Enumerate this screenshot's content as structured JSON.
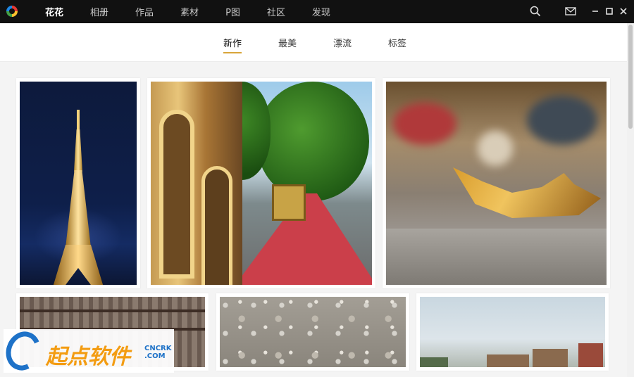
{
  "titlebar": {
    "nav": [
      {
        "label": "花花",
        "active": true
      },
      {
        "label": "相册",
        "active": false
      },
      {
        "label": "作品",
        "active": false
      },
      {
        "label": "素材",
        "active": false
      },
      {
        "label": "P图",
        "active": false
      },
      {
        "label": "社区",
        "active": false
      },
      {
        "label": "发现",
        "active": false
      }
    ],
    "icons": [
      "search-icon",
      "mail-icon",
      "minimize-icon",
      "maximize-icon",
      "close-icon"
    ]
  },
  "subnav": {
    "tabs": [
      {
        "label": "新作",
        "active": true
      },
      {
        "label": "最美",
        "active": false
      },
      {
        "label": "漂流",
        "active": false
      },
      {
        "label": "标签",
        "active": false
      }
    ],
    "accent_color": "#d8a53a"
  },
  "gallery": {
    "photos": [
      "eiffel-tower-night",
      "cable-car-street",
      "autumn-leaf",
      "rusty-fence",
      "gravel-stones",
      "houses-sky"
    ]
  },
  "watermark": {
    "main": "起点软件",
    "brand": "CNCRK",
    "domain": ".COM"
  }
}
